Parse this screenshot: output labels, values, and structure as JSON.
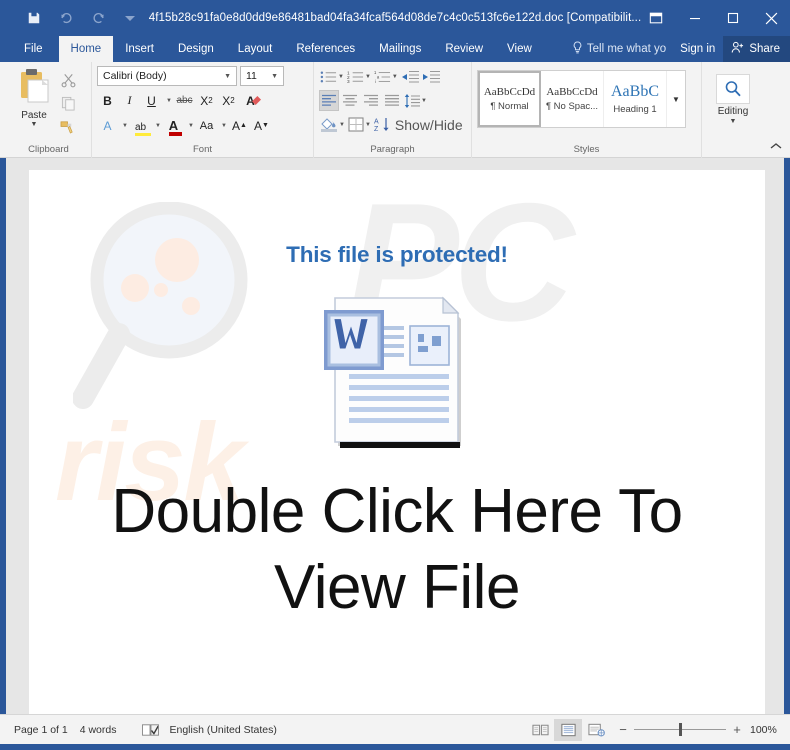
{
  "window": {
    "title": "4f15b28c91fa0e8d0dd9e86481bad04fa34fcaf564d08de7c4c0c513fc6e122d.doc [Compatibilit...",
    "quick_access": [
      {
        "name": "save-icon",
        "label": "Save"
      },
      {
        "name": "undo-icon",
        "label": "Undo"
      },
      {
        "name": "redo-icon",
        "label": "Redo"
      },
      {
        "name": "customize-qat-icon",
        "label": "Customize Quick Access Toolbar"
      }
    ],
    "controls": [
      {
        "name": "ribbon-display-options-icon",
        "label": "Ribbon Display Options"
      },
      {
        "name": "minimize-icon",
        "label": "Minimize"
      },
      {
        "name": "maximize-icon",
        "label": "Maximize"
      },
      {
        "name": "close-icon",
        "label": "Close"
      }
    ]
  },
  "tabs": [
    {
      "label": "File",
      "active": false
    },
    {
      "label": "Home",
      "active": true
    },
    {
      "label": "Insert",
      "active": false
    },
    {
      "label": "Design",
      "active": false
    },
    {
      "label": "Layout",
      "active": false
    },
    {
      "label": "References",
      "active": false
    },
    {
      "label": "Mailings",
      "active": false
    },
    {
      "label": "Review",
      "active": false
    },
    {
      "label": "View",
      "active": false
    }
  ],
  "tellme": {
    "placeholder": "Tell me what yo"
  },
  "signin": {
    "label": "Sign in"
  },
  "share": {
    "label": "Share"
  },
  "ribbon": {
    "clipboard": {
      "group_label": "Clipboard",
      "paste_label": "Paste",
      "cut_label": "Cut",
      "copy_label": "Copy",
      "format_painter_label": "Format Painter"
    },
    "font": {
      "group_label": "Font",
      "font_name": "Calibri (Body)",
      "font_size": "11",
      "bold": "B",
      "italic": "I",
      "underline": "U",
      "strikethrough": "abc",
      "subscript_base": "X",
      "subscript_sub": "2",
      "superscript_base": "X",
      "superscript_sup": "2",
      "clear_formatting": "A",
      "text_effects": "A",
      "highlight": "ab",
      "font_color": "A",
      "change_case": "Aa",
      "grow_font": "A",
      "shrink_font": "A"
    },
    "paragraph": {
      "group_label": "Paragraph",
      "bullets_label": "Bullets",
      "numbering_label": "Numbering",
      "multilevel_label": "Multilevel List",
      "decrease_indent_label": "Decrease Indent",
      "increase_indent_label": "Increase Indent",
      "align_left_label": "Align Left",
      "center_label": "Center",
      "align_right_label": "Align Right",
      "justify_label": "Justify",
      "line_spacing_label": "Line and Paragraph Spacing",
      "shading_label": "Shading",
      "borders_label": "Borders",
      "sort_label": "Sort",
      "show_marks_label": "Show/Hide"
    },
    "styles": {
      "group_label": "Styles",
      "items": [
        {
          "sample": "AaBbCcDd",
          "name": "¶ Normal",
          "selected": true,
          "heading": false
        },
        {
          "sample": "AaBbCcDd",
          "name": "¶ No Spac...",
          "selected": false,
          "heading": false
        },
        {
          "sample": "AaBbC",
          "name": "Heading 1",
          "selected": false,
          "heading": true
        }
      ],
      "more_label": "More"
    },
    "editing": {
      "group_label": "",
      "label": "Editing",
      "icon": "search-icon"
    },
    "collapse_label": "Collapse the Ribbon"
  },
  "document": {
    "watermark_pc": "PC",
    "watermark_risk": "risk",
    "heading": "This file is protected!",
    "icon_name": "word-document-icon",
    "call_to_action": "Double Click Here To View File"
  },
  "statusbar": {
    "page": "Page 1 of 1",
    "words": "4 words",
    "proofing_icon": "proofing-errors-icon",
    "language": "English (United States)",
    "views": [
      {
        "name": "read-mode-icon",
        "label": "Read Mode",
        "selected": false
      },
      {
        "name": "print-layout-icon",
        "label": "Print Layout",
        "selected": true
      },
      {
        "name": "web-layout-icon",
        "label": "Web Layout",
        "selected": false
      }
    ],
    "zoom_out": "−",
    "zoom_in": "+",
    "zoom_level": "100%"
  },
  "colors": {
    "word_blue": "#2b579a",
    "heading_blue": "#2e6db4",
    "ribbon_bg": "#f3f3f3",
    "doc_bg": "#e6e6e6",
    "watermark_gray": "#f0f0f0",
    "watermark_peach": "#fdf0e6"
  }
}
